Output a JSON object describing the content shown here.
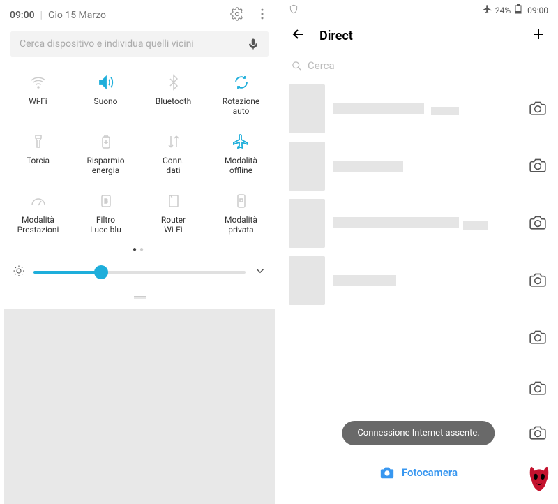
{
  "left": {
    "time": "09:00",
    "date": "Gio 15 Marzo",
    "search_placeholder": "Cerca dispositivo e individua quelli vicini",
    "tiles": [
      {
        "name": "wifi",
        "label": "Wi-Fi",
        "on": false
      },
      {
        "name": "sound",
        "label": "Suono",
        "on": true
      },
      {
        "name": "bluetooth",
        "label": "Bluetooth",
        "on": false
      },
      {
        "name": "rotation",
        "label": "Rotazione\nauto",
        "on": true
      },
      {
        "name": "flashlight",
        "label": "Torcia",
        "on": false
      },
      {
        "name": "battery-saver",
        "label": "Risparmio\nenergia",
        "on": false
      },
      {
        "name": "data",
        "label": "Conn.\ndati",
        "on": false
      },
      {
        "name": "airplane",
        "label": "Modalità\noffline",
        "on": true
      },
      {
        "name": "performance",
        "label": "Modalità\nPrestazioni",
        "on": false
      },
      {
        "name": "blue-light",
        "label": "Filtro\nLuce blu",
        "on": false
      },
      {
        "name": "router",
        "label": "Router\nWi-Fi",
        "on": false
      },
      {
        "name": "private",
        "label": "Modalità\nprivata",
        "on": false
      }
    ],
    "brightness_percent": 32
  },
  "right": {
    "status": {
      "battery": "24%",
      "time": "09:00"
    },
    "title": "Direct",
    "search_placeholder": "Cerca",
    "toast": "Connessione Internet assente.",
    "footer_label": "Fotocamera"
  },
  "colors": {
    "accent": "#1EAEDB",
    "ig_blue": "#3897f0",
    "demon_red": "#C4122E"
  }
}
